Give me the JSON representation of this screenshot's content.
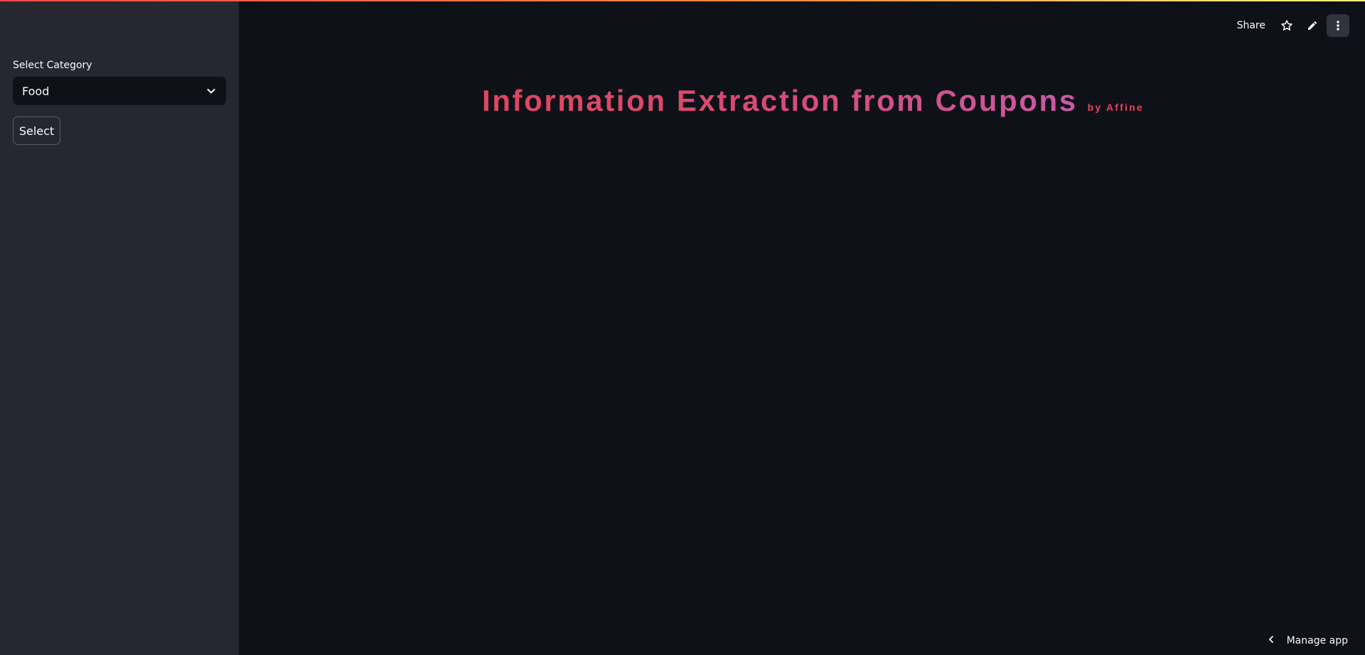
{
  "sidebar": {
    "select_label": "Select Category",
    "dropdown_value": "Food",
    "select_button_label": "Select"
  },
  "header": {
    "share_label": "Share"
  },
  "main": {
    "title": "Information Extraction from Coupons",
    "byline": "by Affine"
  },
  "footer": {
    "manage_app_label": "Manage app"
  },
  "colors": {
    "background": "#0e1117",
    "sidebar": "#262730",
    "title_start": "#e0455f",
    "title_end": "#c85aa6",
    "accent": "#ff4b4b"
  },
  "icons": {
    "dropdown": "chevron-down-icon",
    "favorite": "star-icon",
    "edit": "pencil-icon",
    "menu": "more-vertical-icon",
    "manage": "chevron-left-icon"
  }
}
